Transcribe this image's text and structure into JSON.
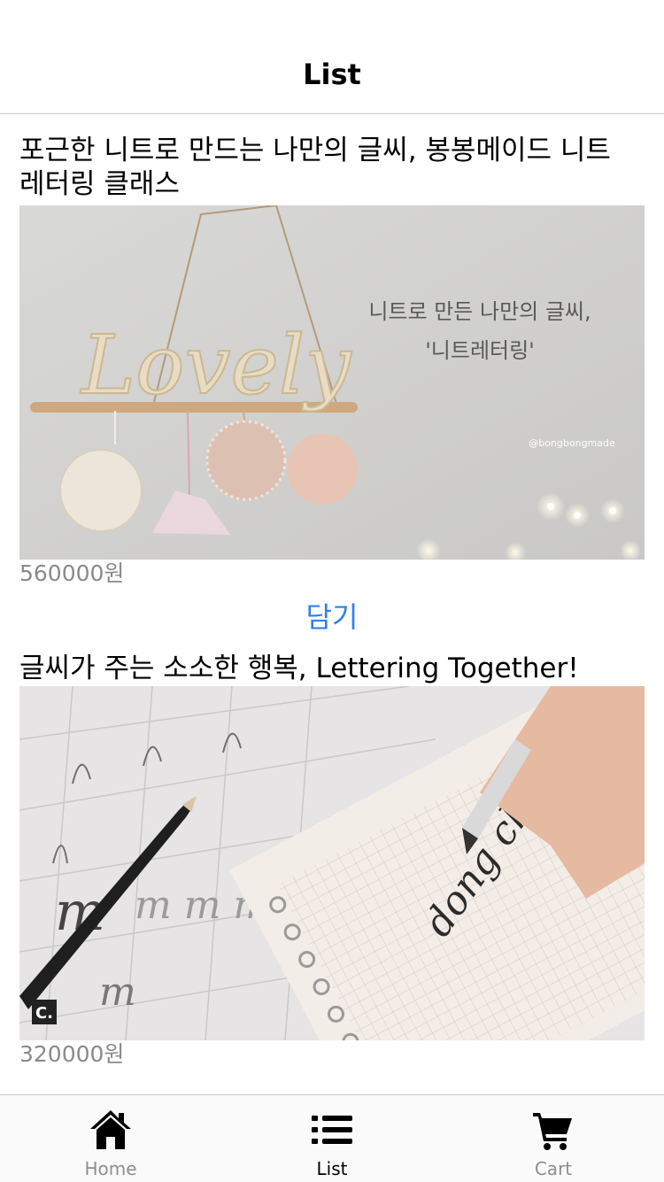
{
  "nav": {
    "title": "List"
  },
  "items": [
    {
      "title": "포근한 니트로 만드는 나만의 글씨, 봉봉메이드 니트 레터링 클래스",
      "image_text_line1": "니트로 만든 나만의 글씨,",
      "image_text_line2": "'니트레터링'",
      "image_word": "Lovely",
      "image_watermark": "@bongbongmade",
      "price": "560000원",
      "add_label": "담기"
    },
    {
      "title": "글씨가 주는 소소한 행복, Lettering Together!",
      "image_handwriting": "dong chan",
      "image_letter": "m",
      "image_badge": "C.",
      "price": "320000원"
    }
  ],
  "tabs": [
    {
      "label": "Home",
      "icon": "home-icon",
      "active": false
    },
    {
      "label": "List",
      "icon": "list-icon",
      "active": true
    },
    {
      "label": "Cart",
      "icon": "cart-icon",
      "active": false
    }
  ],
  "colors": {
    "accent": "#2f80ed",
    "price": "#8a8a8a",
    "tab_inactive": "#8e8e93",
    "tab_active": "#000000",
    "divider": "#c8c8cc"
  }
}
